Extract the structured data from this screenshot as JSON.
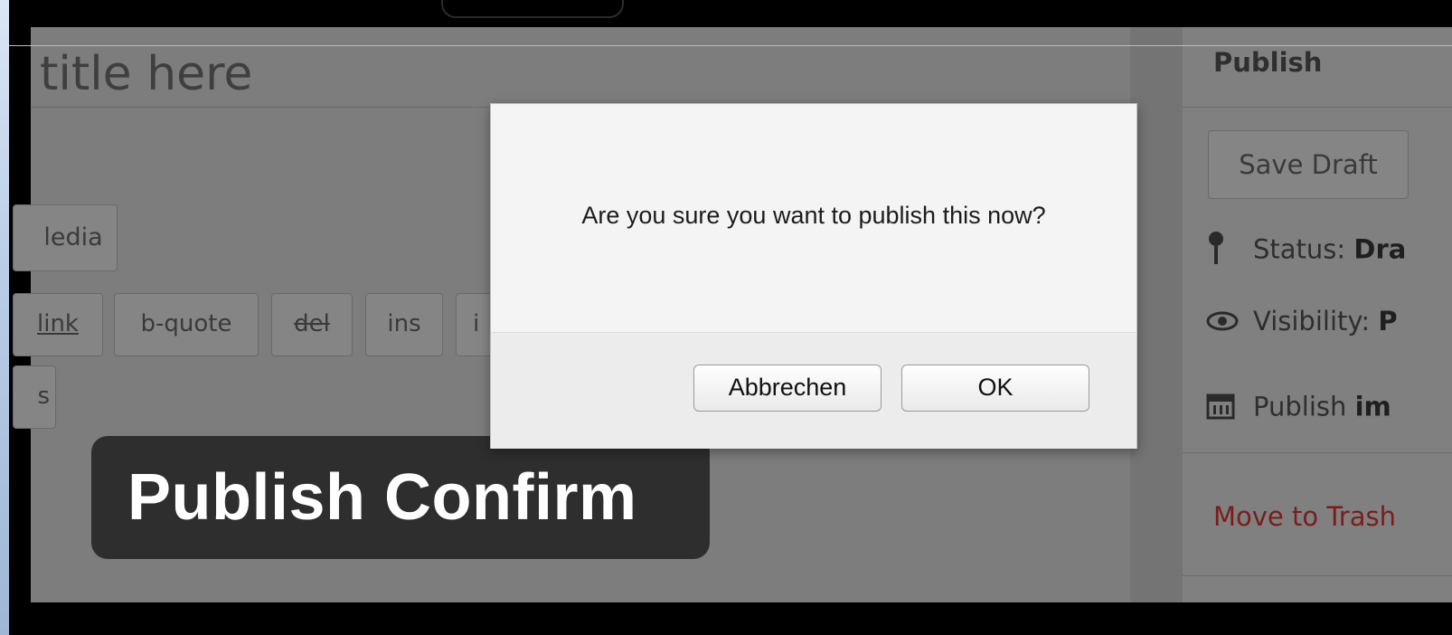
{
  "editor": {
    "title_placeholder": "title here",
    "add_media_label": "ledia",
    "quicktags": {
      "link": "link",
      "b_quote": "b-quote",
      "del": "del",
      "ins": "ins",
      "img": "i",
      "close": "s"
    }
  },
  "publish_box": {
    "title": "Publish",
    "save_draft_label": "Save Draft",
    "status_label": "Status:",
    "status_value": "Dra",
    "visibility_label": "Visibility:",
    "visibility_value": "P",
    "publish_label": "Publish",
    "publish_value": "im",
    "trash_label": "Move to Trash"
  },
  "dialog": {
    "message": "Are you sure you want to publish this now?",
    "cancel_label": "Abbrechen",
    "ok_label": "OK"
  },
  "badge": {
    "text": "Publish Confirm"
  },
  "icons": {
    "status": "pin-icon",
    "visibility": "eye-icon",
    "schedule": "calendar-icon"
  },
  "colors": {
    "trash_link": "#7a1d1d",
    "badge_bg": "#2e2e2e",
    "dialog_bg": "#f4f4f4"
  }
}
